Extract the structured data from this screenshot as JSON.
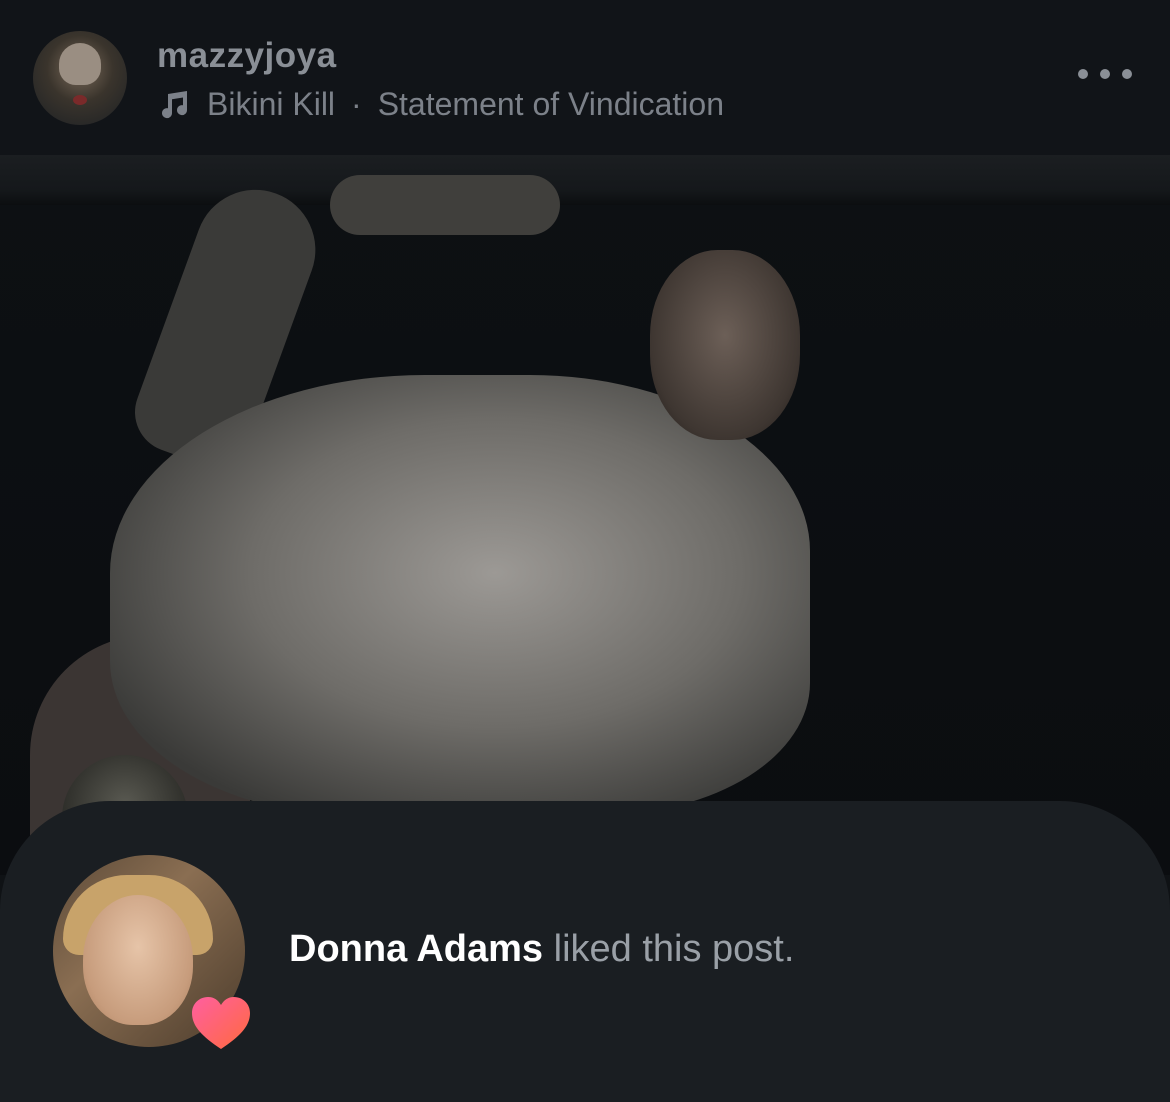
{
  "post_header": {
    "username": "mazzyjoya",
    "music_artist": "Bikini Kill",
    "music_separator": "·",
    "music_track": "Statement of Vindication",
    "music_icon": "music-note-icon",
    "more_icon": "more-options-icon"
  },
  "post_photo": {
    "description_icon": "photo"
  },
  "notification": {
    "liker_name": "Donna Adams",
    "action_text": " liked this post.",
    "reaction_icon": "heart-icon",
    "reaction_color": "#ff4f6e"
  }
}
